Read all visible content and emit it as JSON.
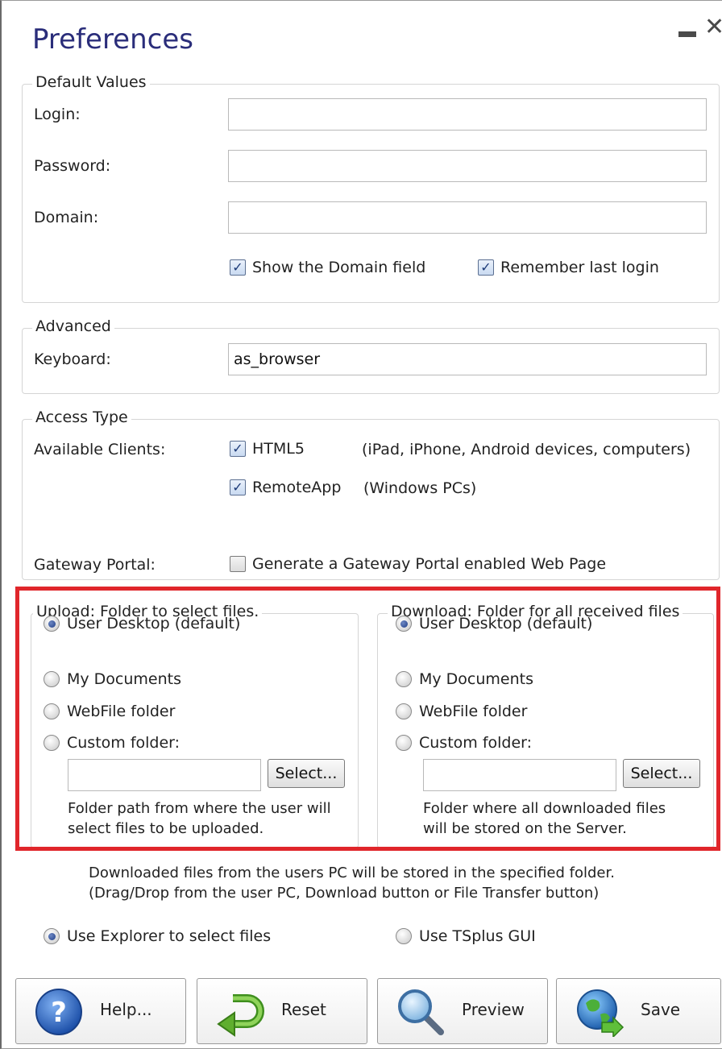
{
  "window": {
    "title": "Preferences"
  },
  "default_values": {
    "legend": "Default Values",
    "login_label": "Login:",
    "login_value": "",
    "password_label": "Password:",
    "password_value": "",
    "domain_label": "Domain:",
    "domain_value": "",
    "show_domain_label": "Show the Domain field",
    "show_domain_checked": true,
    "remember_login_label": "Remember last login",
    "remember_login_checked": true
  },
  "advanced": {
    "legend": "Advanced",
    "keyboard_label": "Keyboard:",
    "keyboard_value": "as_browser"
  },
  "access_type": {
    "legend": "Access Type",
    "available_clients_label": "Available Clients:",
    "html5_label": "HTML5",
    "html5_checked": true,
    "html5_desc": "(iPad, iPhone, Android devices, computers)",
    "remoteapp_label": "RemoteApp",
    "remoteapp_checked": true,
    "remoteapp_desc": "(Windows PCs)",
    "gateway_label": "Gateway Portal:",
    "gateway_option_label": "Generate a Gateway Portal enabled Web Page",
    "gateway_checked": false
  },
  "upload": {
    "legend": "Upload: Folder to select files.",
    "options": [
      "User Desktop (default)",
      "My Documents",
      "WebFile folder",
      "Custom folder:"
    ],
    "selected_index": 0,
    "custom_path": "",
    "select_button": "Select...",
    "note_line1": "Folder path from where the user will",
    "note_line2": "select files to be uploaded."
  },
  "download": {
    "legend": "Download: Folder for all received files",
    "options": [
      "User Desktop (default)",
      "My Documents",
      "WebFile folder",
      "Custom folder:"
    ],
    "selected_index": 0,
    "custom_path": "",
    "select_button": "Select...",
    "note_line1": "Folder where all downloaded files",
    "note_line2": "will be stored on the Server."
  },
  "info": {
    "line1": "Downloaded files from the users PC will be stored in the specified folder.",
    "line2": "(Drag/Drop from the user PC, Download button or File Transfer button)"
  },
  "file_selection": {
    "explorer_label": "Use Explorer to select files",
    "tsplus_label": "Use TSplus GUI",
    "selected": "explorer"
  },
  "buttons": {
    "help": "Help...",
    "reset": "Reset",
    "preview": "Preview",
    "save": "Save"
  },
  "icons": {
    "help": "help-question-icon",
    "reset": "reset-arrow-icon",
    "preview": "magnifier-icon",
    "save": "globe-save-icon"
  },
  "colors": {
    "title": "#2a2d7a",
    "highlight_frame": "#e0262b"
  }
}
